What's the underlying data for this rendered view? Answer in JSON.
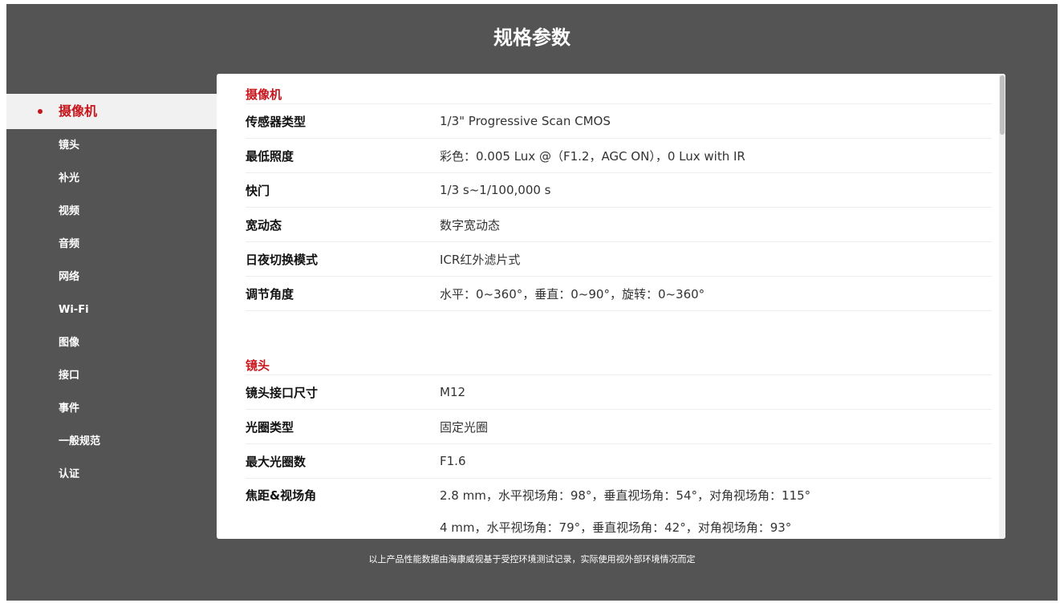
{
  "page": {
    "title": "规格参数"
  },
  "sidebar": {
    "items": [
      {
        "label": "摄像机",
        "active": true
      },
      {
        "label": "镜头"
      },
      {
        "label": "补光"
      },
      {
        "label": "视频"
      },
      {
        "label": "音频"
      },
      {
        "label": "网络"
      },
      {
        "label": "Wi-Fi"
      },
      {
        "label": "图像"
      },
      {
        "label": "接口"
      },
      {
        "label": "事件"
      },
      {
        "label": "一般规范"
      },
      {
        "label": "认证"
      }
    ]
  },
  "sections": [
    {
      "title": "摄像机",
      "rows": [
        {
          "label": "传感器类型",
          "value": "1/3\" Progressive Scan CMOS"
        },
        {
          "label": "最低照度",
          "value": "彩色：0.005 Lux @（F1.2，AGC ON），0 Lux with IR"
        },
        {
          "label": "快门",
          "value": "1/3 s~1/100,000 s"
        },
        {
          "label": "宽动态",
          "value": "数字宽动态"
        },
        {
          "label": "日夜切换模式",
          "value": "ICR红外滤片式"
        },
        {
          "label": "调节角度",
          "value": "水平：0~360°，垂直：0~90°，旋转：0~360°"
        }
      ]
    },
    {
      "title": "镜头",
      "rows": [
        {
          "label": "镜头接口尺寸",
          "value": "M12"
        },
        {
          "label": "光圈类型",
          "value": "固定光圈"
        },
        {
          "label": "最大光圈数",
          "value": "F1.6"
        },
        {
          "label": "焦距&视场角",
          "value": "2.8 mm，水平视场角：98°，垂直视场角：54°，对角视场角：115°"
        },
        {
          "label": "",
          "value": "4 mm，水平视场角：79°，垂直视场角：42°，对角视场角：93°"
        }
      ]
    }
  ],
  "footer": {
    "note": "以上产品性能数据由海康威视基于受控环境测试记录，实际使用视外部环境情况而定"
  },
  "colors": {
    "accent": "#c8161d",
    "background": "#545454"
  }
}
